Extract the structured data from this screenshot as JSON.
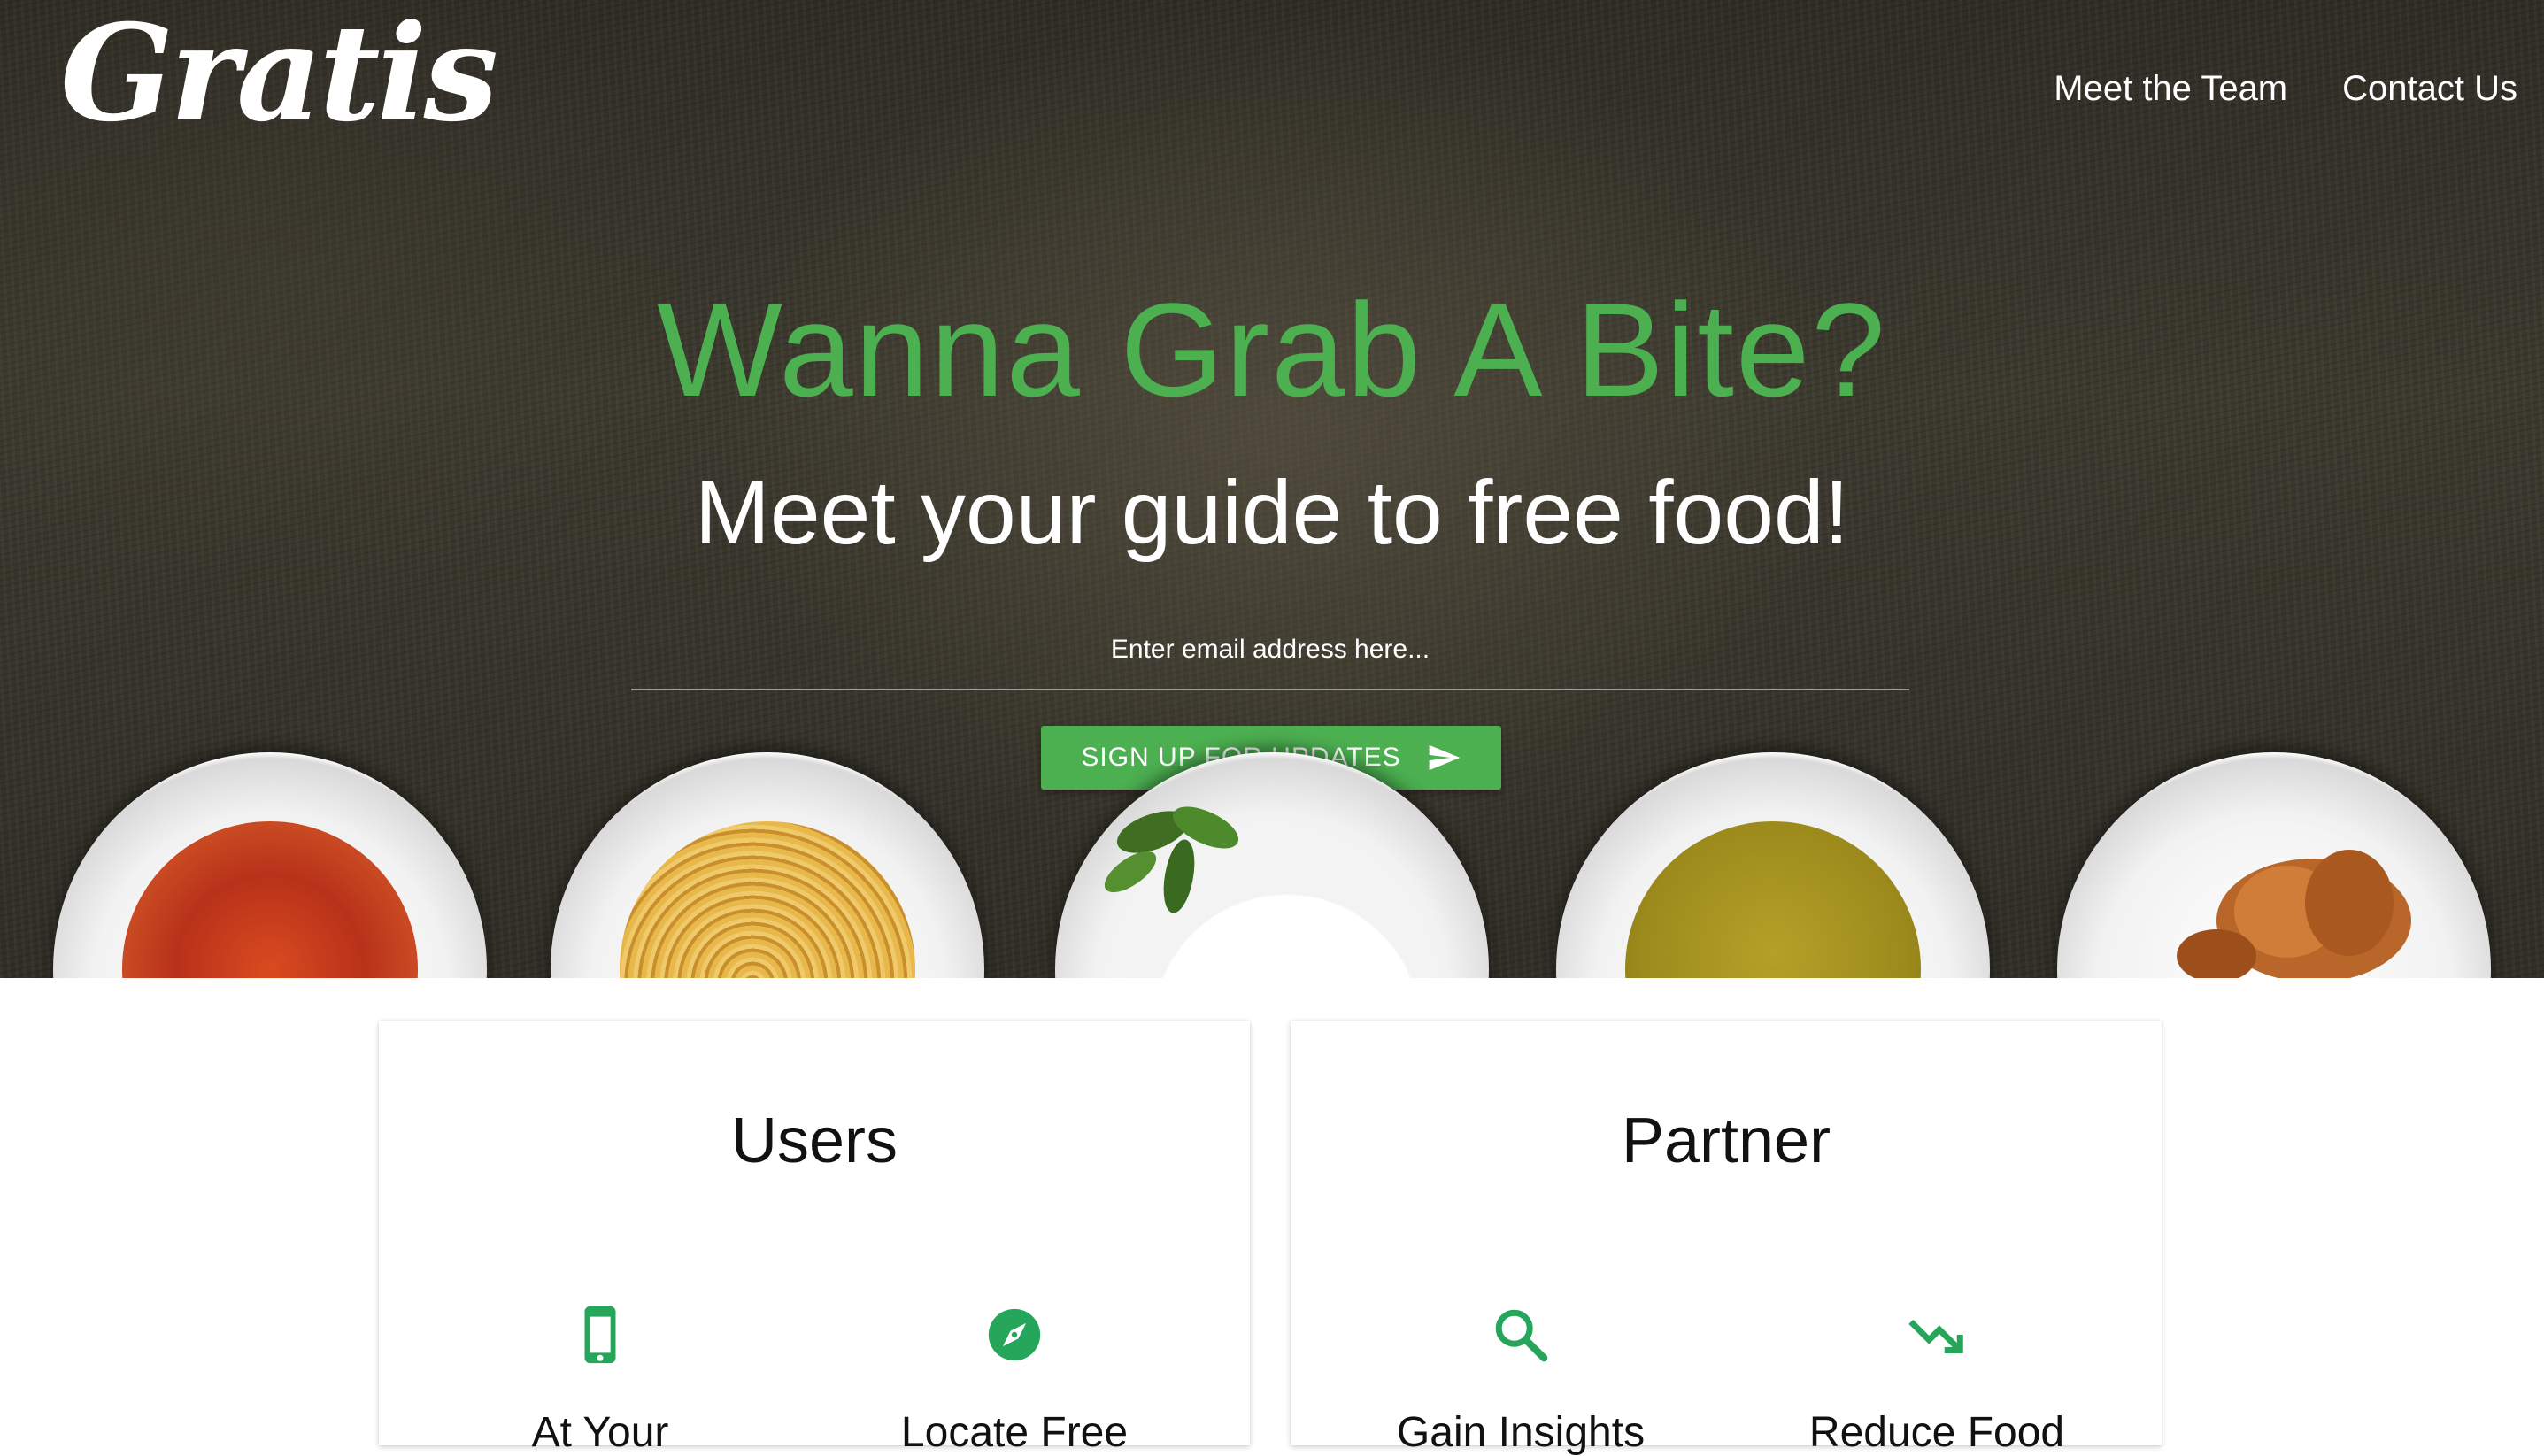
{
  "header": {
    "logo": "Gratis",
    "nav": [
      "Meet the Team",
      "Contact Us"
    ]
  },
  "hero": {
    "headline": "Wanna Grab A Bite?",
    "subhead": "Meet your guide to free food!",
    "email_placeholder": "Enter email address here...",
    "signup_label": "SIGN UP FOR UPDATES"
  },
  "sections": [
    {
      "title": "Users",
      "features": [
        {
          "icon": "smartphone-icon",
          "label": "At Your"
        },
        {
          "icon": "compass-icon",
          "label": "Locate Free"
        }
      ]
    },
    {
      "title": "Partner",
      "features": [
        {
          "icon": "search-icon",
          "label": "Gain Insights"
        },
        {
          "icon": "trending-down-icon",
          "label": "Reduce Food"
        }
      ]
    }
  ],
  "colors": {
    "accent": "#4caf50",
    "hero_bg": "#2f2c24",
    "text_light": "#ffffff"
  }
}
